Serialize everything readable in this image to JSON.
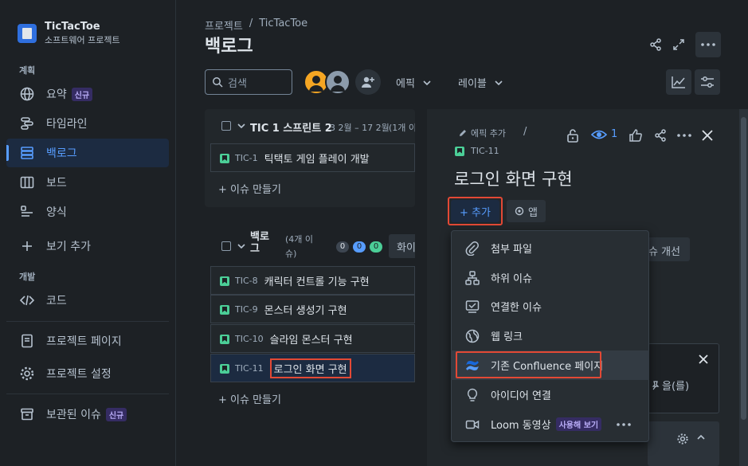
{
  "project": {
    "name": "TicTacToe",
    "subtitle": "소프트웨어 프로젝트"
  },
  "sidebar": {
    "section_plan": "계획",
    "section_dev": "개발",
    "items": [
      {
        "label": "요약",
        "badge": "신규"
      },
      {
        "label": "타임라인"
      },
      {
        "label": "백로그"
      },
      {
        "label": "보드"
      },
      {
        "label": "양식"
      },
      {
        "label": "보기 추가"
      },
      {
        "label": "코드"
      },
      {
        "label": "프로젝트 페이지"
      },
      {
        "label": "프로젝트 설정"
      },
      {
        "label": "보관된 이슈",
        "badge": "신규"
      }
    ]
  },
  "breadcrumb": {
    "root": "프로젝트",
    "sep": "/",
    "project": "TicTacToe"
  },
  "page_title": "백로그",
  "toolbar": {
    "search_placeholder": "검색",
    "epic": "에픽",
    "label": "레이블"
  },
  "sprint": {
    "name": "TIC 1 스프린트 2",
    "dates": "3 2월 – 17 2월",
    "count": "(1개 이",
    "issues": [
      {
        "key": "TIC-1",
        "summary": "틱택토 게임 플레이 개발"
      }
    ],
    "create": "+ 이슈 만들기"
  },
  "backlog": {
    "name_line1": "백로",
    "name_line2": "그",
    "count_line1": "(4개 이",
    "count_line2": "슈)",
    "counts": [
      "0",
      "0",
      "0"
    ],
    "btn": "화이",
    "issues": [
      {
        "key": "TIC-8",
        "summary": "캐릭터 컨트롤 기능 구현"
      },
      {
        "key": "TIC-9",
        "summary": "몬스터 생성기 구현"
      },
      {
        "key": "TIC-10",
        "summary": "슬라임 몬스터 구현"
      },
      {
        "key": "TIC-11",
        "summary": "로그인 화면 구현"
      }
    ],
    "create": "+ 이슈 만들기"
  },
  "detail": {
    "epic_add": "에픽 추가",
    "sep": "/",
    "key": "TIC-11",
    "watchers": "1",
    "title": "로그인 화면 구현",
    "add_btn": "+ 추가",
    "apps_btn": "앱",
    "improve_btn": "슈 개선",
    "side_text": "을(를)"
  },
  "add_menu": [
    {
      "label": "첨부 파일",
      "icon": "paperclip-icon"
    },
    {
      "label": "하위 이슈",
      "icon": "subtask-icon"
    },
    {
      "label": "연결한 이슈",
      "icon": "linked-issue-icon"
    },
    {
      "label": "웹 링크",
      "icon": "globe-icon"
    },
    {
      "label": "기존 Confluence 페이지",
      "icon": "confluence-icon"
    },
    {
      "label": "아이디어 연결",
      "icon": "lightbulb-icon"
    },
    {
      "label": "Loom 동영상",
      "icon": "video-icon",
      "badge": "사용해 보기"
    }
  ]
}
